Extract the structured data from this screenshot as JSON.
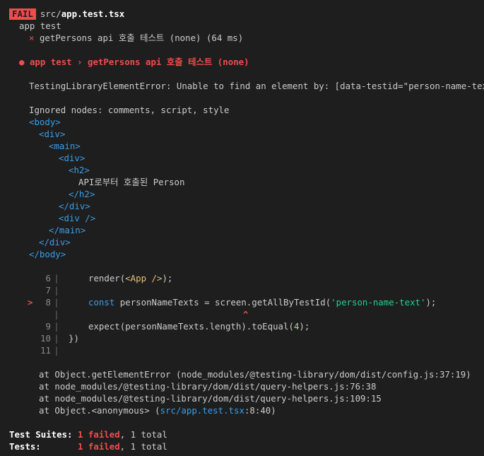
{
  "header": {
    "badge": "FAIL",
    "path_dir": "src/",
    "path_file": "app.test.tsx"
  },
  "suite": {
    "name": "app test",
    "test_mark": "×",
    "test_line": "getPersons api 호출 테스트 (none) (64 ms)"
  },
  "failure": {
    "bullet": "●",
    "title": "app test › getPersons api 호출 테스트 (none)",
    "error": "TestingLibraryElementError: Unable to find an element by: [data-testid=\"person-name-text\"]",
    "ignored": "Ignored nodes: comments, script, style"
  },
  "dom": {
    "body_open": "<body>",
    "div_open": "<div>",
    "main_open": "<main>",
    "div2_open": "<div>",
    "h2_open": "<h2>",
    "h2_text": "API로부터 호출된 Person",
    "h2_close": "</h2>",
    "div2_close": "</div>",
    "div_empty": "<div />",
    "main_close": "</main>",
    "div_close": "</div>",
    "body_close": "</body>"
  },
  "code": {
    "bar": "|",
    "marker": ">",
    "caret": "^",
    "lines": [
      {
        "num": "6",
        "pre": "render(",
        "jsx": "<App />",
        "post": ");"
      },
      {
        "num": "7"
      },
      {
        "num": "8",
        "kw": "const",
        "mid": " personNameTexts = screen.getAllByTestId(",
        "str": "'person-name-text'",
        "post": ");"
      },
      {
        "num": "9",
        "pre": "expect(personNameTexts.length).toEqual(",
        "numval": "4",
        "post": ");"
      },
      {
        "num": "10",
        "pre": "})"
      },
      {
        "num": "11"
      }
    ]
  },
  "stack": [
    {
      "text": "at Object.getElementError (node_modules/@testing-library/dom/dist/config.js:37:19)"
    },
    {
      "text": "at node_modules/@testing-library/dom/dist/query-helpers.js:76:38"
    },
    {
      "text": "at node_modules/@testing-library/dom/dist/query-helpers.js:109:15"
    },
    {
      "pre": "at Object.<anonymous> (",
      "link": "src/app.test.tsx",
      "post": ":8:40)"
    }
  ],
  "summary": {
    "suites_label": "Test Suites:",
    "suites_failed": "1 failed",
    "suites_total": ", 1 total",
    "tests_label": "Tests:",
    "tests_failed": "1 failed",
    "tests_total": ", 1 total"
  },
  "colors": {
    "background": "#1e1e1e",
    "fail_red": "#f14c4c",
    "tag_blue": "#3b9ee8",
    "string_green": "#23d18b",
    "jsx_yellow": "#e5c07b"
  }
}
